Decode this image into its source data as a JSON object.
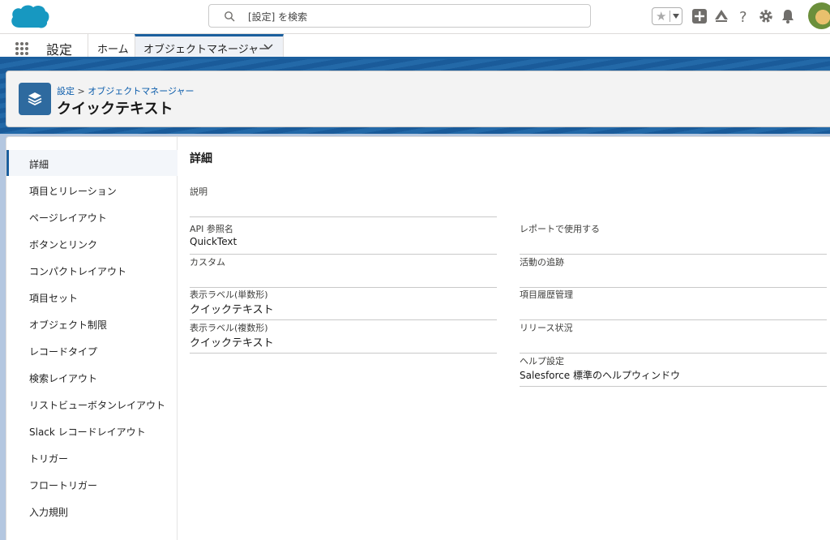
{
  "header": {
    "search_placeholder": "[設定] を検索"
  },
  "nav": {
    "app_name": "設定",
    "tabs": [
      {
        "label": "ホーム"
      },
      {
        "label": "オブジェクトマネージャー"
      }
    ]
  },
  "page": {
    "breadcrumb_root": "設定",
    "breadcrumb_sep": ">",
    "breadcrumb_leaf": "オブジェクトマネージャー",
    "title": "クイックテキスト"
  },
  "sidebar": {
    "items": [
      {
        "label": "詳細"
      },
      {
        "label": "項目とリレーション"
      },
      {
        "label": "ページレイアウト"
      },
      {
        "label": "ボタンとリンク"
      },
      {
        "label": "コンパクトレイアウト"
      },
      {
        "label": "項目セット"
      },
      {
        "label": "オブジェクト制限"
      },
      {
        "label": "レコードタイプ"
      },
      {
        "label": "検索レイアウト"
      },
      {
        "label": "リストビューボタンレイアウト"
      },
      {
        "label": "Slack レコードレイアウト"
      },
      {
        "label": "トリガー"
      },
      {
        "label": "フロートリガー"
      },
      {
        "label": "入力規則"
      }
    ]
  },
  "details": {
    "section_title": "詳細",
    "left": [
      {
        "label": "説明",
        "value": ""
      },
      {
        "label": "API 参照名",
        "value": "QuickText"
      },
      {
        "label": "カスタム",
        "value": ""
      },
      {
        "label": "表示ラベル(単数形)",
        "value": "クイックテキスト"
      },
      {
        "label": "表示ラベル(複数形)",
        "value": "クイックテキスト"
      }
    ],
    "right": [
      {
        "label": "レポートで使用する",
        "value": ""
      },
      {
        "label": "活動の追跡",
        "value": ""
      },
      {
        "label": "項目履歴管理",
        "value": ""
      },
      {
        "label": "リリース状況",
        "value": ""
      },
      {
        "label": "ヘルプ設定",
        "value": "Salesforce 標準のヘルプウィンドウ"
      }
    ]
  },
  "colors": {
    "brand": "#0b5cab",
    "header_band": "#1a5b9a",
    "object_icon": "#2e6a9f"
  }
}
